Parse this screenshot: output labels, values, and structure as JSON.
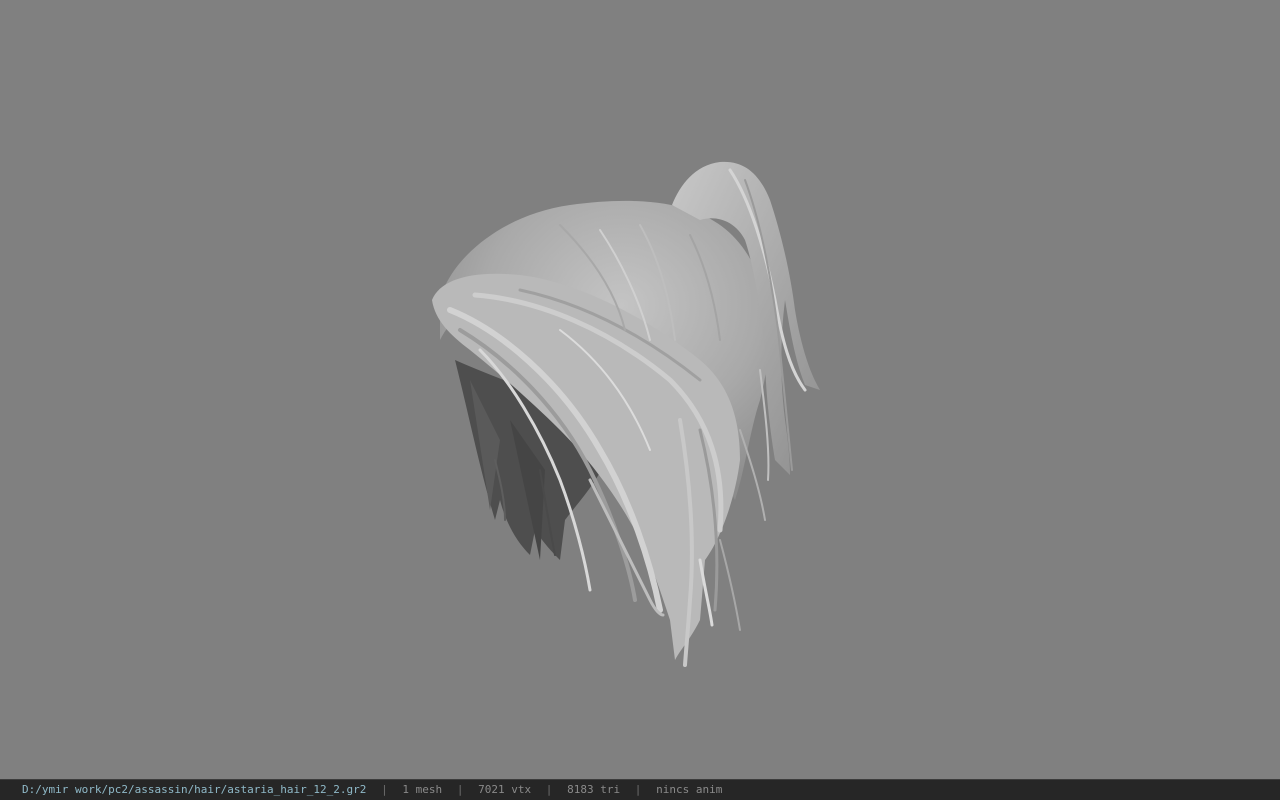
{
  "viewer": {
    "background_color": "#808080",
    "model_color": "#b4b4b4",
    "model_description": ""
  },
  "status": {
    "file_path": "D:/ymir work/pc2/assassin/hair/astaria_hair_12_2.gr2",
    "mesh_count": "1 mesh",
    "vertex_count": "7021 vtx",
    "triangle_count": "8183 tri",
    "anim_status": "nincs anim",
    "separator": "|"
  }
}
